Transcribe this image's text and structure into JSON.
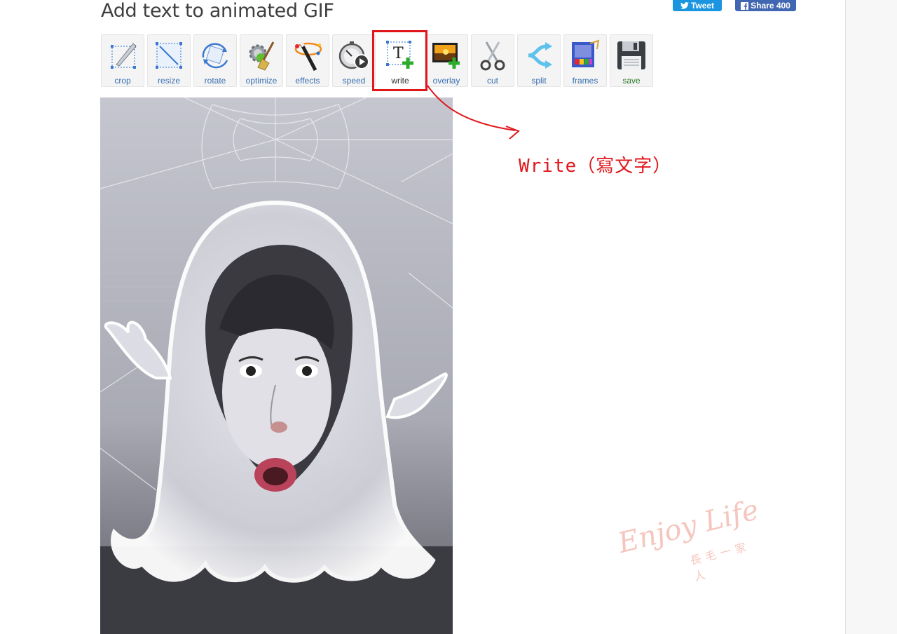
{
  "page": {
    "title": "Add text to animated GIF"
  },
  "social": {
    "tweet_label": "Tweet",
    "share_label": "Share 400"
  },
  "toolbar": {
    "tools": [
      {
        "label": "crop",
        "icon": "crop-icon"
      },
      {
        "label": "resize",
        "icon": "resize-icon"
      },
      {
        "label": "rotate",
        "icon": "rotate-icon"
      },
      {
        "label": "optimize",
        "icon": "optimize-icon"
      },
      {
        "label": "effects",
        "icon": "effects-icon"
      },
      {
        "label": "speed",
        "icon": "speed-icon"
      },
      {
        "label": "write",
        "icon": "write-icon",
        "active": true
      },
      {
        "label": "overlay",
        "icon": "overlay-icon"
      },
      {
        "label": "cut",
        "icon": "scissors-icon"
      },
      {
        "label": "split",
        "icon": "split-icon"
      },
      {
        "label": "frames",
        "icon": "frames-icon"
      },
      {
        "label": "save",
        "icon": "floppy-disk-icon"
      }
    ]
  },
  "annotation": {
    "text": "Write（寫文字）",
    "color": "#e0161b"
  },
  "watermark": {
    "main": "Enjoy Life",
    "sub": "長毛一家人"
  },
  "colors": {
    "link_blue": "#3a6fb0",
    "save_green": "#2f7d2f",
    "tweet_blue": "#1b95e0",
    "facebook_blue": "#4267b2"
  }
}
